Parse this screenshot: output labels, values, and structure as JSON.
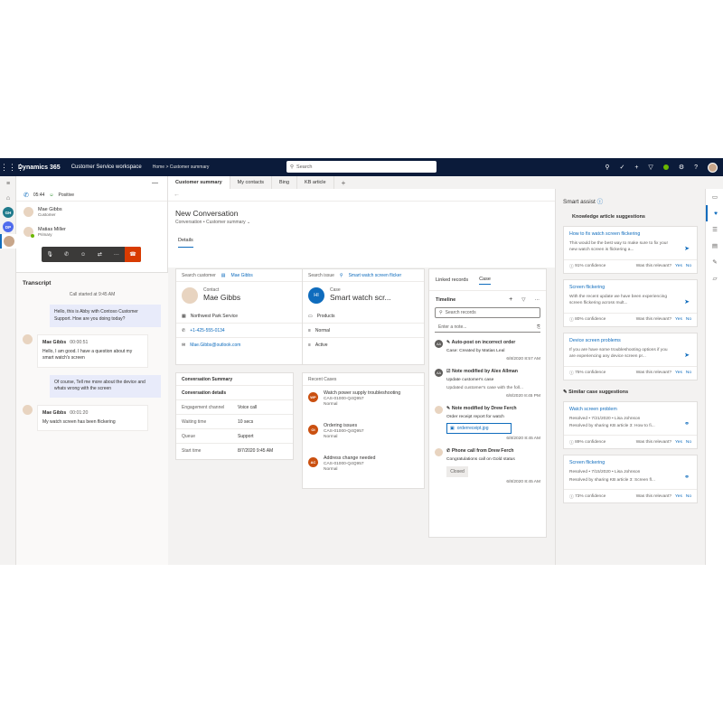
{
  "topbar": {
    "brand": "Dynamics 365",
    "app": "Customer Service workspace",
    "crumb_home": "Home",
    "crumb_sep": ">",
    "crumb_current": "Customer summary",
    "search_placeholder": "Search"
  },
  "rail": {
    "avatars": [
      {
        "initials": "GH",
        "color": "#1f7a8c"
      },
      {
        "initials": "DP",
        "color": "#4f6bed"
      }
    ]
  },
  "session": {
    "call_time": "05:44",
    "sentiment": "Positive",
    "participants": [
      {
        "name": "Mae Gibbs",
        "role": "Customer"
      },
      {
        "name": "Matias Miller",
        "role": "Primary"
      }
    ]
  },
  "transcript": {
    "title": "Transcript",
    "started": "Call started at 9:45 AM",
    "messages": [
      {
        "side": "right",
        "text": "Hello, this is Abby with Contoso Customer Support. How are you doing today?"
      },
      {
        "side": "left",
        "name": "Mae Gibbs",
        "time": "00:00:51",
        "text": "Hello, I am good. I have a question about my smart watch's screen"
      },
      {
        "side": "right",
        "text": "Of course, Tell me more about the device and whats wrong with the screen"
      },
      {
        "side": "left",
        "name": "Mae Gibbs",
        "time": "00:01:20",
        "text": "My watch screen has been flickering"
      }
    ]
  },
  "tabs": [
    "Customer summary",
    "My contacts",
    "Bing",
    "KB article"
  ],
  "main": {
    "title": "New Conversation",
    "subtitle": "Conversation • Customer summary",
    "detail_tab": "Details",
    "customer": {
      "search_label": "Search customer",
      "search_value": "Mae Gibbs",
      "type": "Contact",
      "name": "Mae Gibbs",
      "company": "Northwest Park Service",
      "phone": "+1-425-555-0134",
      "email": "Mae.Gibbs@outlook.com"
    },
    "issue": {
      "search_label": "Search issue",
      "search_value": "Smart watch screen flicker",
      "initials": "HI",
      "type": "Case",
      "name": "Smart watch scr...",
      "rows": [
        "Products",
        "Normal",
        "Active"
      ]
    },
    "conversation_summary": {
      "title": "Conversation Summary",
      "subtitle": "Conversation details",
      "rows": [
        {
          "k": "Engagement channel",
          "v": "Voice call"
        },
        {
          "k": "Waiting time",
          "v": "10 secs"
        },
        {
          "k": "Queue",
          "v": "Support"
        },
        {
          "k": "Start time",
          "v": "8/7/2020 9:45 AM"
        }
      ]
    },
    "recent_cases": {
      "title": "Recent Cases",
      "items": [
        {
          "initials": "WP",
          "color": "#ca5010",
          "title": "Watch power supply troubleshooting",
          "id": "CAS-01000-Q4Q957",
          "priority": "Normal"
        },
        {
          "initials": "OI",
          "color": "#ca5010",
          "title": "Ordering issues",
          "id": "CAS-01000-Q4Q957",
          "priority": "Normal"
        },
        {
          "initials": "AC",
          "color": "#ca5010",
          "title": "Address change needed",
          "id": "CAS-01000-Q4Q957",
          "priority": "Normal"
        }
      ]
    },
    "timeline": {
      "tabs": [
        "Linked records",
        "Case"
      ],
      "title": "Timeline",
      "search_placeholder": "Search records",
      "note_placeholder": "Enter a note...",
      "items": [
        {
          "icon": "AA",
          "title": "Auto-post on incorrect order",
          "body": "Case: Created by Matias Leal",
          "date": "6/8/2020 8:57 AM"
        },
        {
          "icon": "AA",
          "title": "Note modified by Alex Allman",
          "body": "Update customer's case",
          "body2": "Updated customer's case with the foll...",
          "date": "6/8/2020 8:45 PM"
        },
        {
          "icon": "DF",
          "title": "Note modified by Drew Ferch",
          "body": "Order receipt report for watch",
          "file": "orderreceipt.jpg",
          "date": "6/8/2020 8:45 AM"
        },
        {
          "icon": "DF",
          "title": "Phone call from Drew Ferch",
          "body": "Congratulations call on Gold status",
          "badge": "Closed",
          "date": "6/8/2020 8:45 AM"
        }
      ]
    }
  },
  "assist": {
    "title": "Smart assist",
    "kb_title": "Knowledge article suggestions",
    "kb": [
      {
        "title": "How to fix watch screen flickering",
        "body": "This would be the best way to make sure to fix your new watch screen is flickering a...",
        "confidence": "91% confidence"
      },
      {
        "title": "Screen flickering",
        "body": "With the recent update we have been experiencing screen flickering across mult...",
        "confidence": "80% confidence"
      },
      {
        "title": "Device screen problems",
        "body": "If you are have some troubleshooting options if you are experiencing any device screen pr...",
        "confidence": "75% confidence"
      }
    ],
    "cases_title": "Similar case suggestions",
    "cases": [
      {
        "title": "Watch screen problem",
        "meta": "Resolved • 7/21/2020 • Lisa Johnson",
        "body": "Resolved by sharing KB article 3: How to fi...",
        "confidence": "89% confidence"
      },
      {
        "title": "Screen flickering",
        "meta": "Resolved • 7/15/2020 • Lisa Johnson",
        "body": "Resolved by sharing KB article 3: Screen fl...",
        "confidence": "73% confidence"
      }
    ],
    "relevant": "Was this relevant?",
    "yes": "Yes",
    "no": "No"
  }
}
